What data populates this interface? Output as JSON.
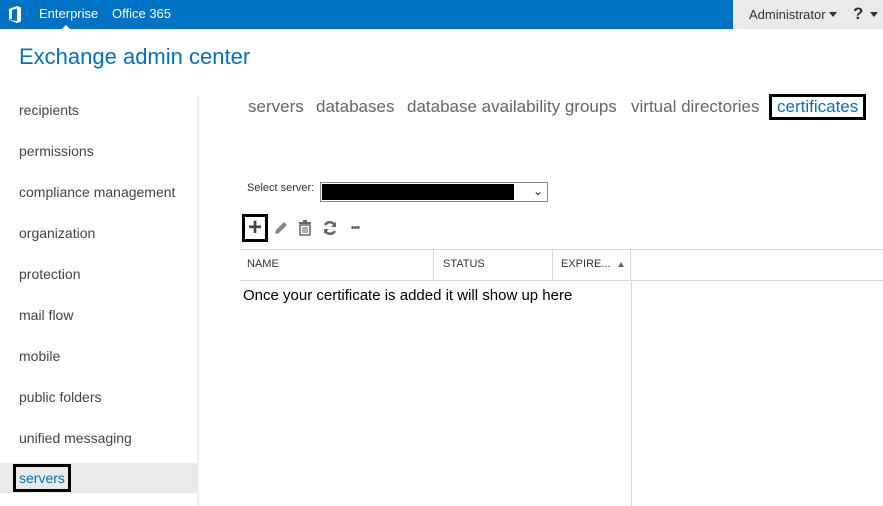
{
  "topbar": {
    "logo_icon": "office-logo-icon",
    "nav": [
      "Enterprise",
      "Office 365"
    ],
    "user": "Administrator",
    "help": "?"
  },
  "app_title": "Exchange admin center",
  "sidebar": {
    "items": [
      {
        "label": "recipients"
      },
      {
        "label": "permissions"
      },
      {
        "label": "compliance management"
      },
      {
        "label": "organization"
      },
      {
        "label": "protection"
      },
      {
        "label": "mail flow"
      },
      {
        "label": "mobile"
      },
      {
        "label": "public folders"
      },
      {
        "label": "unified messaging"
      },
      {
        "label": "servers",
        "active": true
      }
    ]
  },
  "tabs": [
    {
      "label": "servers"
    },
    {
      "label": "databases"
    },
    {
      "label": "database availability groups"
    },
    {
      "label": "virtual directories"
    },
    {
      "label": "certificates",
      "active": true
    }
  ],
  "select_server": {
    "label": "Select server:",
    "value": ""
  },
  "toolbar": {
    "add": "+",
    "edit_icon": "pencil-icon",
    "delete_icon": "trash-icon",
    "refresh_icon": "refresh-icon",
    "more": "•••"
  },
  "table": {
    "columns": [
      "NAME",
      "STATUS",
      "EXPIRE..."
    ],
    "sort_column": "EXPIRE...",
    "empty_message": "Once your certificate is added it will show up here"
  },
  "colors": {
    "brand": "#0072c6",
    "highlight": "#000000"
  }
}
